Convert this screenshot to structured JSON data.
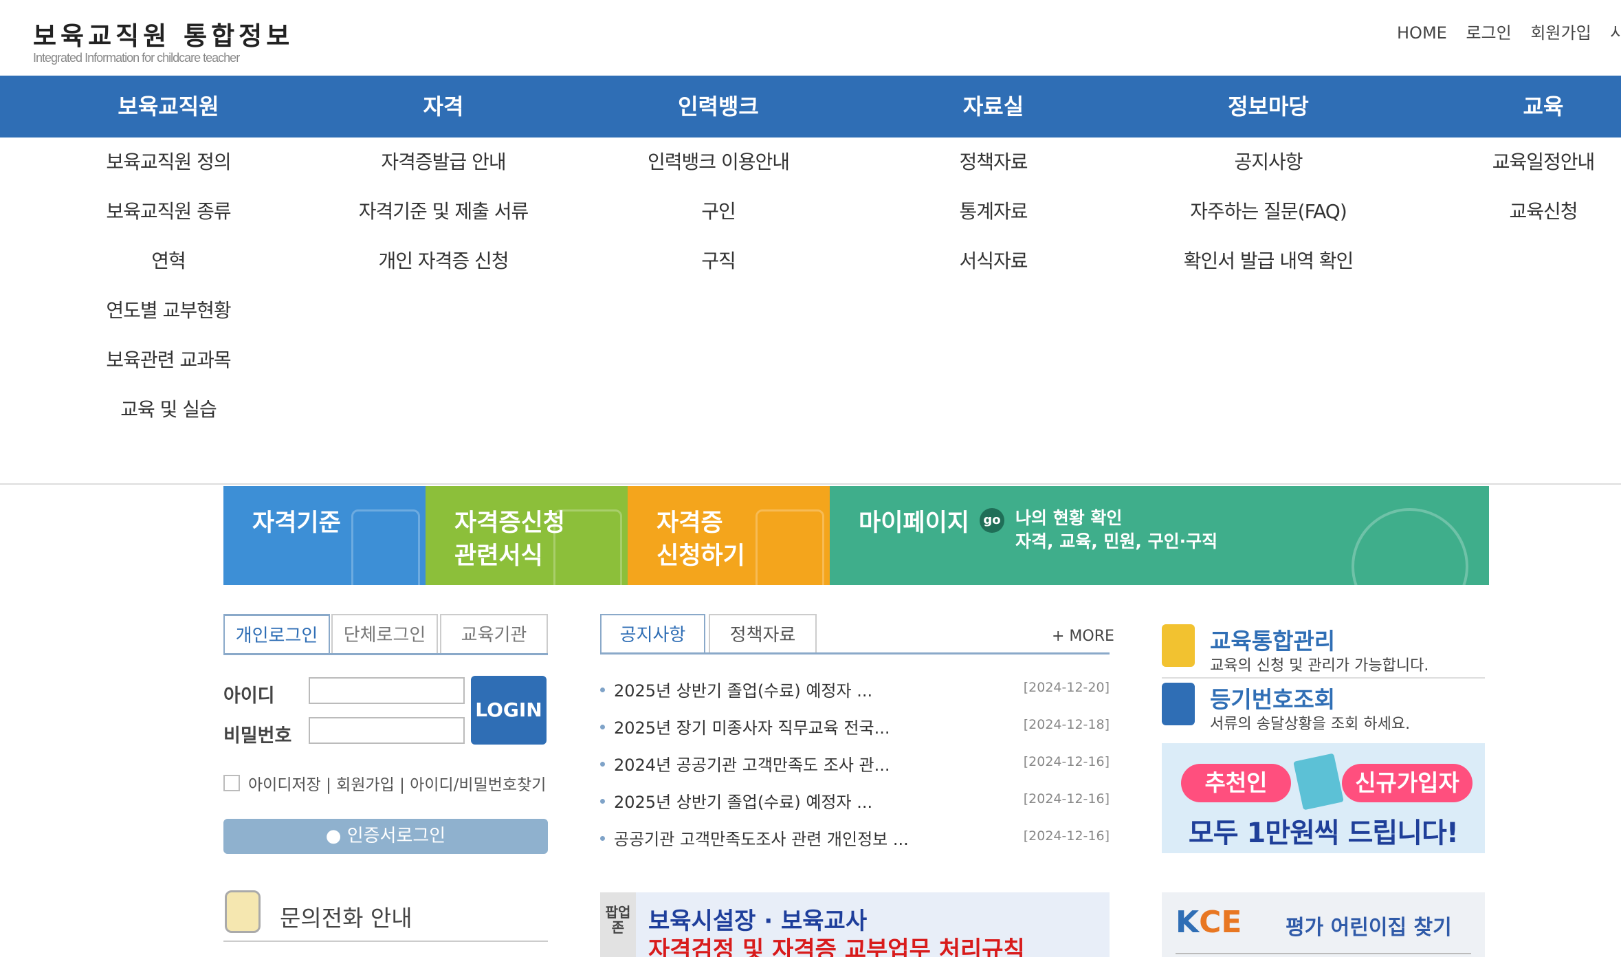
{
  "header": {
    "title": "보육교직원 통합정보",
    "subtitle": "Integrated Information for childcare teacher",
    "util_links": [
      "HOME",
      "로그인",
      "회원가입",
      "사이"
    ]
  },
  "nav": [
    {
      "label": "보육교직원",
      "items": [
        "보육교직원 정의",
        "보육교직원 종류",
        "연혁",
        "연도별 교부현황",
        "보육관련 교과목",
        "교육 및 실습"
      ]
    },
    {
      "label": "자격",
      "items": [
        "자격증발급 안내",
        "자격기준 및 제출 서류",
        "개인 자격증 신청"
      ]
    },
    {
      "label": "인력뱅크",
      "items": [
        "인력뱅크 이용안내",
        "구인",
        "구직"
      ]
    },
    {
      "label": "자료실",
      "items": [
        "정책자료",
        "통계자료",
        "서식자료"
      ]
    },
    {
      "label": "정보마당",
      "items": [
        "공지사항",
        "자주하는 질문(FAQ)",
        "확인서 발급 내역 확인"
      ]
    },
    {
      "label": "교육",
      "items": [
        "교육일정안내",
        "교육신청"
      ]
    }
  ],
  "banners": {
    "b1": "자격기준",
    "b2_l1": "자격증신청",
    "b2_l2": "관련서식",
    "b3_l1": "자격증",
    "b3_l2": "신청하기",
    "b4_title": "마이페이지",
    "b4_go": "go",
    "b4_l1": "나의 현황 확인",
    "b4_l2": "자격, 교육, 민원, 구인·구직"
  },
  "login": {
    "tabs": [
      "개인로그인",
      "단체로그인",
      "교육기관"
    ],
    "id_label": "아이디",
    "pw_label": "비밀번호",
    "login_btn": "LOGIN",
    "options": "아이디저장 | 회원가입 | 아이디/비밀번호찾기",
    "cert_btn": "인증서로그인"
  },
  "inquiry": {
    "title": "문의전화 안내"
  },
  "notices": {
    "tabs": [
      "공지사항",
      "정책자료"
    ],
    "more": "+ MORE",
    "rows": [
      {
        "title": "2025년 상반기 졸업(수료) 예정자 ...",
        "date": "[2024-12-20]"
      },
      {
        "title": "2025년 장기 미종사자 직무교육 전국...",
        "date": "[2024-12-18]"
      },
      {
        "title": "2024년 공공기관 고객만족도 조사 관...",
        "date": "[2024-12-16]"
      },
      {
        "title": "2025년 상반기 졸업(수료) 예정자 ...",
        "date": "[2024-12-16]"
      },
      {
        "title": "공공기관 고객만족도조사 관련 개인정보 ...",
        "date": "[2024-12-16]"
      }
    ]
  },
  "popup_zone": {
    "label": "팝업존",
    "line1": "보육시설장 · 보육교사",
    "line2": "자격검정 및 자격증 교부업무 처리규칙"
  },
  "right": {
    "edu": {
      "title": "교육통합관리",
      "desc": "교육의 신청 및 관리가 가능합니다."
    },
    "reg": {
      "title": "등기번호조회",
      "desc": "서류의 송달상황을 조회 하세요."
    },
    "promo": {
      "left": "추천인",
      "right": "신규가입자",
      "main": "모두 1만원씩 드립니다!"
    },
    "kce": {
      "logo_k": "K",
      "logo_rest": "CE",
      "text": "평가 어린이집 찾기"
    }
  },
  "colors": {
    "nav_bg": "#2f6eb5",
    "b1": "#3d8fd6",
    "b2": "#8cbf3a",
    "b3": "#f4a51c",
    "b4": "#3fae8b"
  }
}
